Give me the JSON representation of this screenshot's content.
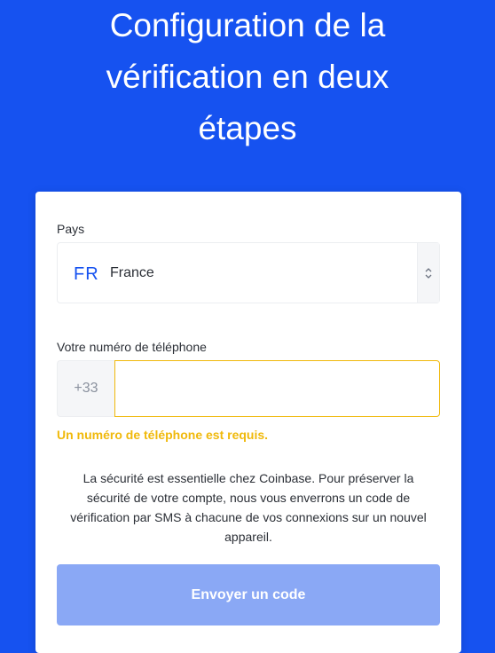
{
  "page": {
    "title_lines": [
      "Configuration de la",
      "vérification en deux",
      "étapes"
    ]
  },
  "form": {
    "country_label": "Pays",
    "country_code": "FR",
    "country_name": "France",
    "phone_label": "Votre numéro de téléphone",
    "phone_prefix": "+33",
    "phone_value": "",
    "error_text": "Un numéro de téléphone est requis.",
    "notice_lines": [
      "La sécurité est essentielle chez Coinbase. Pour préserver la",
      "sécurité de votre compte, nous vous enverrons un code de",
      "vérification par SMS à chacune de vos connexions sur un nouvel",
      "appareil."
    ],
    "send_button_label": "Envoyer un code"
  },
  "colors": {
    "background": "#1652f0",
    "accent": "#1652f0",
    "error": "#f0b90b",
    "button_disabled": "#8aa8f5"
  },
  "icons": {
    "select_arrows": "chevron-up-down-icon"
  }
}
